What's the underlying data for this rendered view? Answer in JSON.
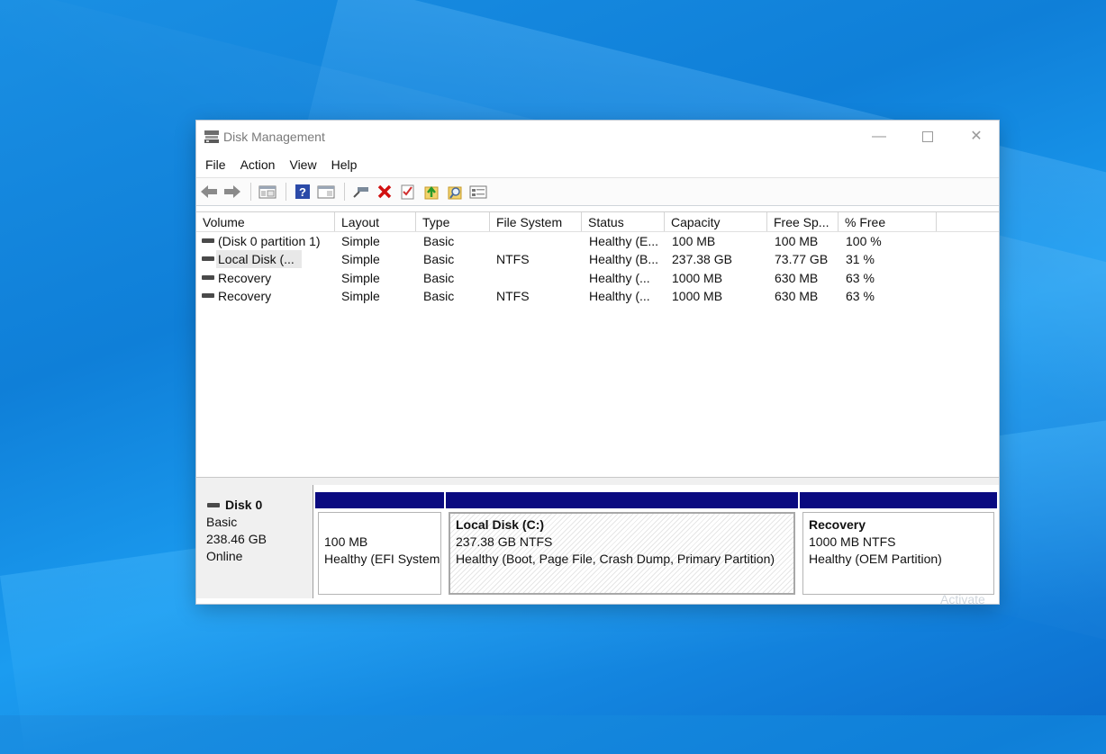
{
  "window": {
    "title": "Disk Management",
    "minimize": "—",
    "close": "✕"
  },
  "menu": [
    "File",
    "Action",
    "View",
    "Help"
  ],
  "toolbar": [
    "back-arrow-icon",
    "forward-arrow-icon",
    "console-tree-icon",
    "help-icon",
    "show-pane-icon",
    "connect-disk-icon",
    "delete-icon",
    "checklist-icon",
    "import-icon",
    "find-icon",
    "properties-icon"
  ],
  "columns": [
    "Volume",
    "Layout",
    "Type",
    "File System",
    "Status",
    "Capacity",
    "Free Sp...",
    "% Free"
  ],
  "volumes": [
    {
      "volume": "(Disk 0 partition 1)",
      "layout": "Simple",
      "type": "Basic",
      "fs": "",
      "status": "Healthy (E...",
      "capacity": "100 MB",
      "free": "100 MB",
      "pct": "100 %"
    },
    {
      "volume": "Local Disk (...",
      "layout": "Simple",
      "type": "Basic",
      "fs": "NTFS",
      "status": "Healthy (B...",
      "capacity": "237.38 GB",
      "free": "73.77 GB",
      "pct": "31 %"
    },
    {
      "volume": "Recovery",
      "layout": "Simple",
      "type": "Basic",
      "fs": "",
      "status": "Healthy (...",
      "capacity": "1000 MB",
      "free": "630 MB",
      "pct": "63 %"
    },
    {
      "volume": "Recovery",
      "layout": "Simple",
      "type": "Basic",
      "fs": "NTFS",
      "status": "Healthy (...",
      "capacity": "1000 MB",
      "free": "630 MB",
      "pct": "63 %"
    }
  ],
  "disk": {
    "name": "Disk 0",
    "kind": "Basic",
    "size": "238.46 GB",
    "state": "Online"
  },
  "partitions": [
    {
      "name": "",
      "size": "100 MB",
      "status": "Healthy (EFI System"
    },
    {
      "name": "Local Disk  (C:)",
      "size": "237.38 GB NTFS",
      "status": "Healthy (Boot, Page File, Crash Dump, Primary Partition)"
    },
    {
      "name": "Recovery",
      "size": "1000 MB NTFS",
      "status": "Healthy (OEM Partition)"
    }
  ],
  "watermark": "Activate",
  "colors": {
    "partition_bar": "#0a0a80",
    "desktop": "#1a8fe3"
  }
}
